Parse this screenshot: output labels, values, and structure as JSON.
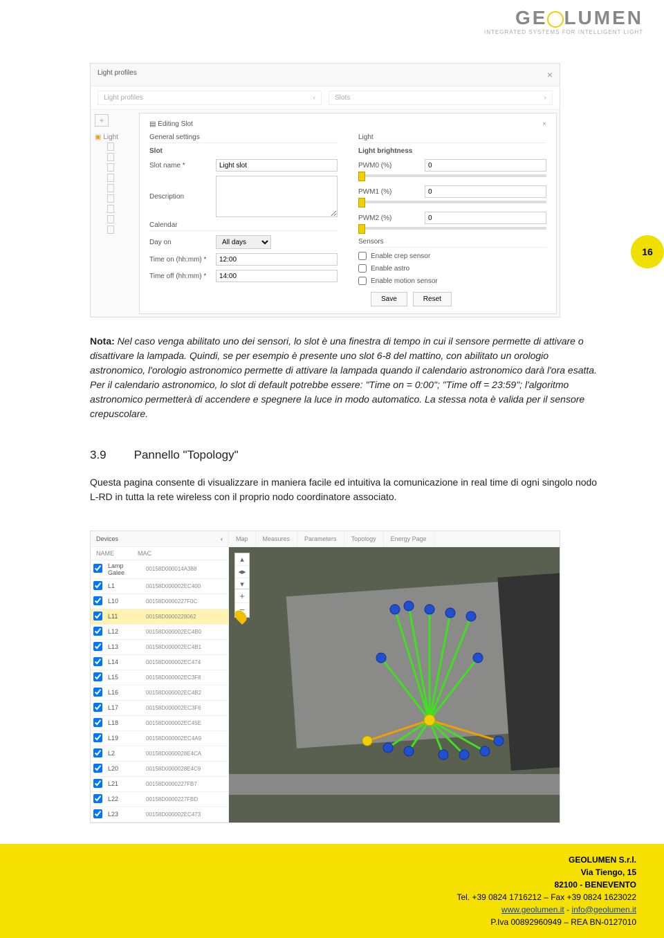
{
  "logo": {
    "main": "GE LUMEN",
    "sub": "INTEGRATED SYSTEMS FOR INTELLIGENT LIGHT"
  },
  "page_badge": "16",
  "shot1": {
    "title": "Light profiles",
    "subtab_left": "Light profiles",
    "subtab_right": "Slots",
    "sidebar_root": "Light",
    "dialog_title": "Editing Slot",
    "left": {
      "fs_general": "General settings",
      "slot_heading": "Slot",
      "slot_name_label": "Slot name *",
      "slot_name_value": "Light slot",
      "desc_label": "Description",
      "fs_calendar": "Calendar",
      "dayon_label": "Day on",
      "dayon_value": "All days",
      "timeon_label": "Time on (hh:mm) *",
      "timeon_value": "12:00",
      "timeoff_label": "Time off (hh:mm) *",
      "timeoff_value": "14:00"
    },
    "right": {
      "fs_light": "Light",
      "bright_heading": "Light brightness",
      "pwm0_label": "PWM0 (%)",
      "pwm0_value": "0",
      "pwm1_label": "PWM1 (%)",
      "pwm1_value": "0",
      "pwm2_label": "PWM2 (%)",
      "pwm2_value": "0",
      "fs_sensors": "Sensors",
      "sens_crep": "Enable crep sensor",
      "sens_astro": "Enable astro",
      "sens_motion": "Enable motion sensor",
      "btn_save": "Save",
      "btn_reset": "Reset"
    }
  },
  "text": {
    "nota_label": "Nota:",
    "nota_body": " Nel caso venga abilitato uno dei sensori, lo slot è una finestra di tempo in cui il sensore permette di attivare o disattivare la lampada. Quindi, se per esempio è presente uno slot 6-8 del mattino, con abilitato un orologio astronomico, l'orologio astronomico permette di attivare la lampada quando il calendario astronomico darà l'ora esatta. Per il calendario astronomico, lo slot di default potrebbe essere: \"Time on = 0:00\"; \"Time off = 23:59\"; l'algoritmo astronomico permetterà di accendere e spegnere la luce in modo automatico. La stessa nota è valida per il sensore crepuscolare.",
    "h2_num": "3.9",
    "h2_title": "Pannello \"Topology\"",
    "topo_body": "Questa pagina consente di visualizzare in maniera facile ed intuitiva la comunicazione in real time di ogni singolo nodo L-RD in tutta la rete wireless con il proprio nodo coordinatore associato."
  },
  "shot2": {
    "devices_title": "Devices",
    "col_name": "NAME",
    "col_mac": "MAC",
    "tabs": [
      "Map",
      "Measures",
      "Parameters",
      "Topology",
      "Energy Page"
    ],
    "rows": [
      {
        "n": "Lamp Galee",
        "m": "00158D000014A388",
        "sel": false
      },
      {
        "n": "L1",
        "m": "00158D000002EC400",
        "sel": false
      },
      {
        "n": "L10",
        "m": "00158D0000227F0C",
        "sel": false
      },
      {
        "n": "L11",
        "m": "00158D0000228062",
        "sel": true
      },
      {
        "n": "L12",
        "m": "00158D000002EC4B0",
        "sel": false
      },
      {
        "n": "L13",
        "m": "00158D000002EC4B1",
        "sel": false
      },
      {
        "n": "L14",
        "m": "00158D000002EC474",
        "sel": false
      },
      {
        "n": "L15",
        "m": "00158D000002EC3F8",
        "sel": false
      },
      {
        "n": "L16",
        "m": "00158D000002EC4B2",
        "sel": false
      },
      {
        "n": "L17",
        "m": "00158D000002EC3F6",
        "sel": false
      },
      {
        "n": "L18",
        "m": "00158D000002EC45E",
        "sel": false
      },
      {
        "n": "L19",
        "m": "00158D000002EC4A9",
        "sel": false
      },
      {
        "n": "L2",
        "m": "00158D0000028E4CA",
        "sel": false
      },
      {
        "n": "L20",
        "m": "00158D0000028E4C9",
        "sel": false
      },
      {
        "n": "L21",
        "m": "00158D0000227FB7",
        "sel": false
      },
      {
        "n": "L22",
        "m": "00158D0000227FBD",
        "sel": false
      },
      {
        "n": "L23",
        "m": "00158D000002EC473",
        "sel": false
      }
    ]
  },
  "footer": {
    "company": "GEOLUMEN S.r.l.",
    "addr1": "Via Tiengo, 15",
    "addr2": "82100 - BENEVENTO",
    "tel": "Tel. +39 0824 1716212 – Fax +39 0824 1623022",
    "web": "www.geolumen.it",
    "sep": " - ",
    "mail": "info@geolumen.it",
    "piva": "P.Iva 00892960949 – REA BN-0127010"
  }
}
